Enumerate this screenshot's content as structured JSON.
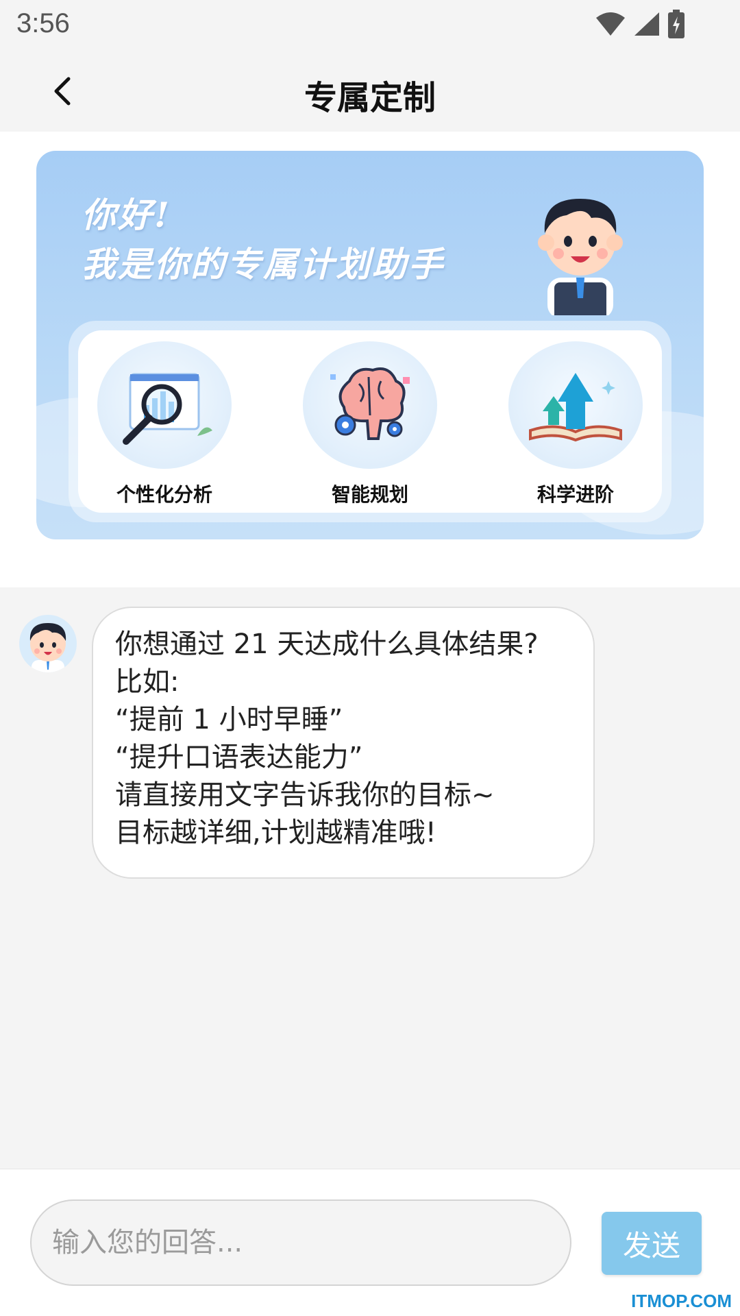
{
  "status_bar": {
    "time": "3:56",
    "icons": [
      "wifi-icon",
      "signal-icon",
      "battery-charging-icon"
    ]
  },
  "header": {
    "title": "专属定制",
    "back_icon": "chevron-left-icon"
  },
  "banner": {
    "greeting_line1": "你好!",
    "greeting_line2": "我是你的专属计划助手",
    "features": [
      {
        "label": "个性化分析",
        "icon": "magnifier-chart-icon"
      },
      {
        "label": "智能规划",
        "icon": "brain-gears-icon"
      },
      {
        "label": "科学进阶",
        "icon": "book-arrows-icon"
      }
    ]
  },
  "chat": {
    "message_lines": [
      "你想通过 21 天达成什么具体结果?",
      "比如:",
      "“提前 1 小时早睡”",
      "“提升口语表达能力”",
      "请直接用文字告诉我你的目标~",
      "目标越详细,计划越精准哦!"
    ]
  },
  "input": {
    "placeholder": "输入您的回答...",
    "value": "",
    "send_label": "发送"
  },
  "watermark": "ITMOP.COM",
  "colors": {
    "banner_bg": "#a6cdf5",
    "send_button": "#85c8ec",
    "watermark": "#1a8fd4"
  }
}
